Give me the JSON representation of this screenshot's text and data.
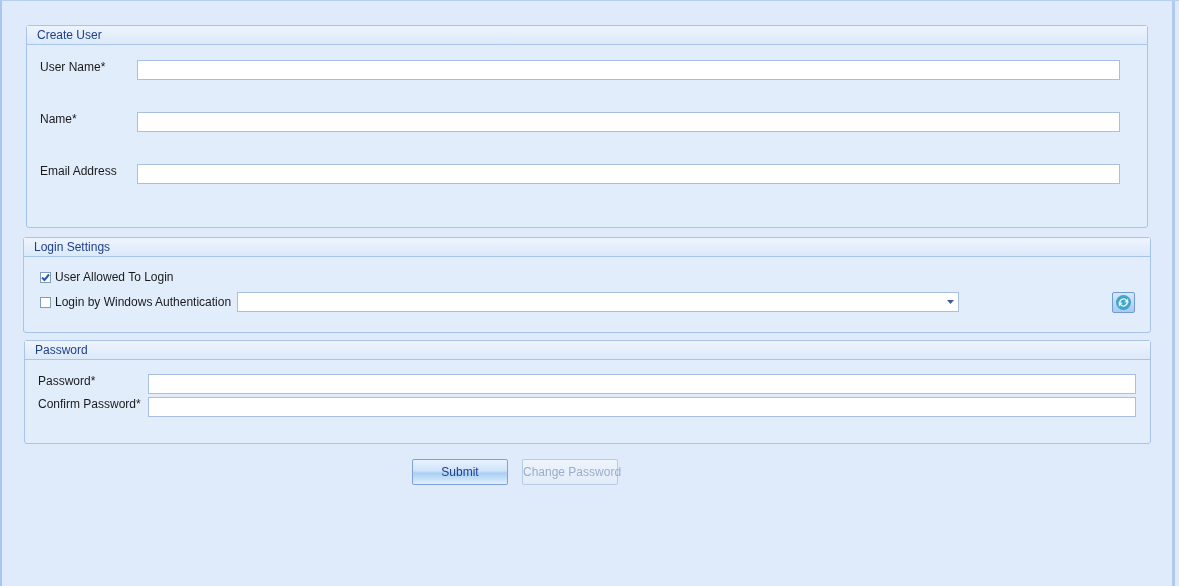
{
  "create_user": {
    "title": "Create User",
    "fields": [
      {
        "label": "User Name*"
      },
      {
        "label": "Name*"
      },
      {
        "label": "Email Address"
      }
    ]
  },
  "login_settings": {
    "title": "Login Settings",
    "options": [
      {
        "label": "User Allowed To Login",
        "checked": true
      },
      {
        "label": "Login by Windows Authentication",
        "checked": false
      }
    ]
  },
  "password": {
    "title": "Password",
    "fields": [
      {
        "label": "Password*"
      },
      {
        "label": "Confirm Password*"
      }
    ]
  },
  "buttons": [
    {
      "label": "Submit",
      "disabled": false
    },
    {
      "label": "Change Password",
      "disabled": true
    }
  ]
}
